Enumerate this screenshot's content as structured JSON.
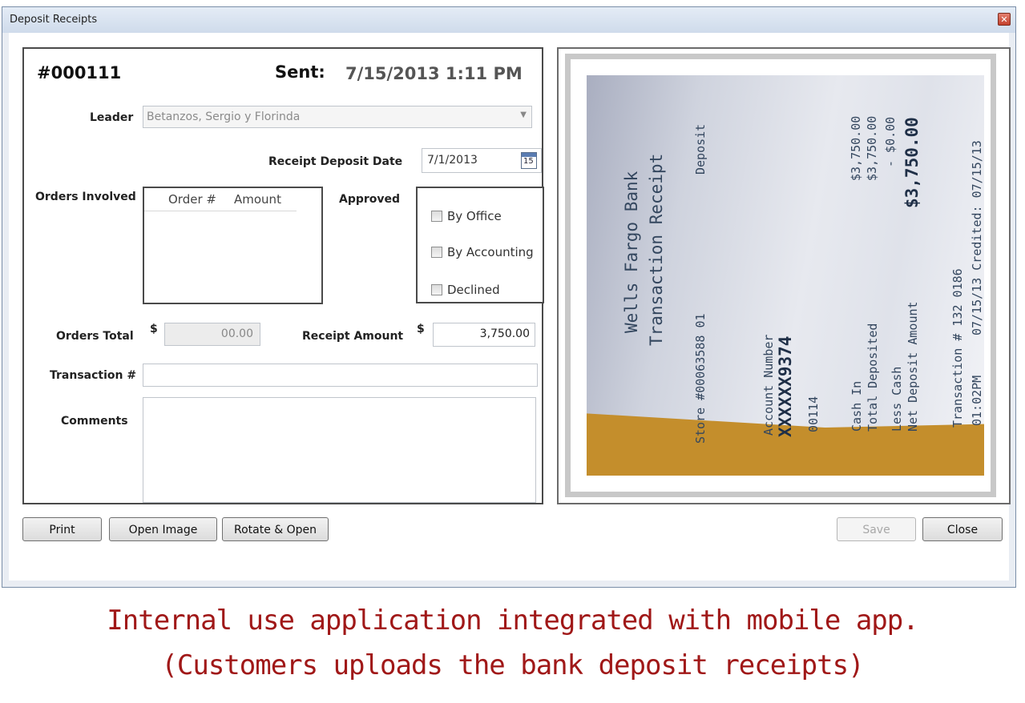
{
  "window": {
    "title": "Deposit Receipts"
  },
  "header": {
    "receipt_number": "#000111",
    "sent_label": "Sent:",
    "sent_value": "7/15/2013 1:11 PM"
  },
  "form": {
    "leader_label": "Leader",
    "leader_value": "Betanzos, Sergio y Florinda",
    "deposit_date_label": "Receipt Deposit Date",
    "deposit_date_value": "7/1/2013",
    "calendar_day": "15",
    "orders_involved_label": "Orders Involved",
    "orders_columns": [
      "Order #",
      "Amount"
    ],
    "approved_label": "Approved",
    "approved_options": [
      "By Office",
      "By Accounting",
      "Declined"
    ],
    "orders_total_label": "Orders Total",
    "currency_symbol": "$",
    "orders_total_value": "00.00",
    "receipt_amount_label": "Receipt Amount",
    "receipt_amount_value": "3,750.00",
    "transaction_label": "Transaction #",
    "transaction_value": "",
    "comments_label": "Comments",
    "comments_value": ""
  },
  "buttons": {
    "print": "Print",
    "open_image": "Open Image",
    "rotate_open": "Rotate & Open",
    "save": "Save",
    "close": "Close"
  },
  "receipt_image": {
    "bank": "Wells Fargo Bank",
    "doc": "Transaction Receipt",
    "type": "Deposit",
    "store": "Store #00063588 01",
    "account_label": "Account Number",
    "account_number": "XXXXXX9374",
    "code": "00114",
    "cash_in": "Cash In",
    "total_deposited": "Total Deposited",
    "less_cash": "Less Cash",
    "net_deposit": "Net Deposit Amount",
    "amt1": "$3,750.00",
    "amt2": "$3,750.00",
    "amt3": "- $0.00",
    "net_amount": "$3,750.00",
    "transaction_line": "Transaction # 132 0186",
    "credited_line": "07/15/13 Credited: 07/15/13",
    "time_line": "01:02PM"
  },
  "caption": {
    "line1": "Internal use application integrated with mobile app.",
    "line2": "(Customers uploads the bank deposit receipts)"
  }
}
